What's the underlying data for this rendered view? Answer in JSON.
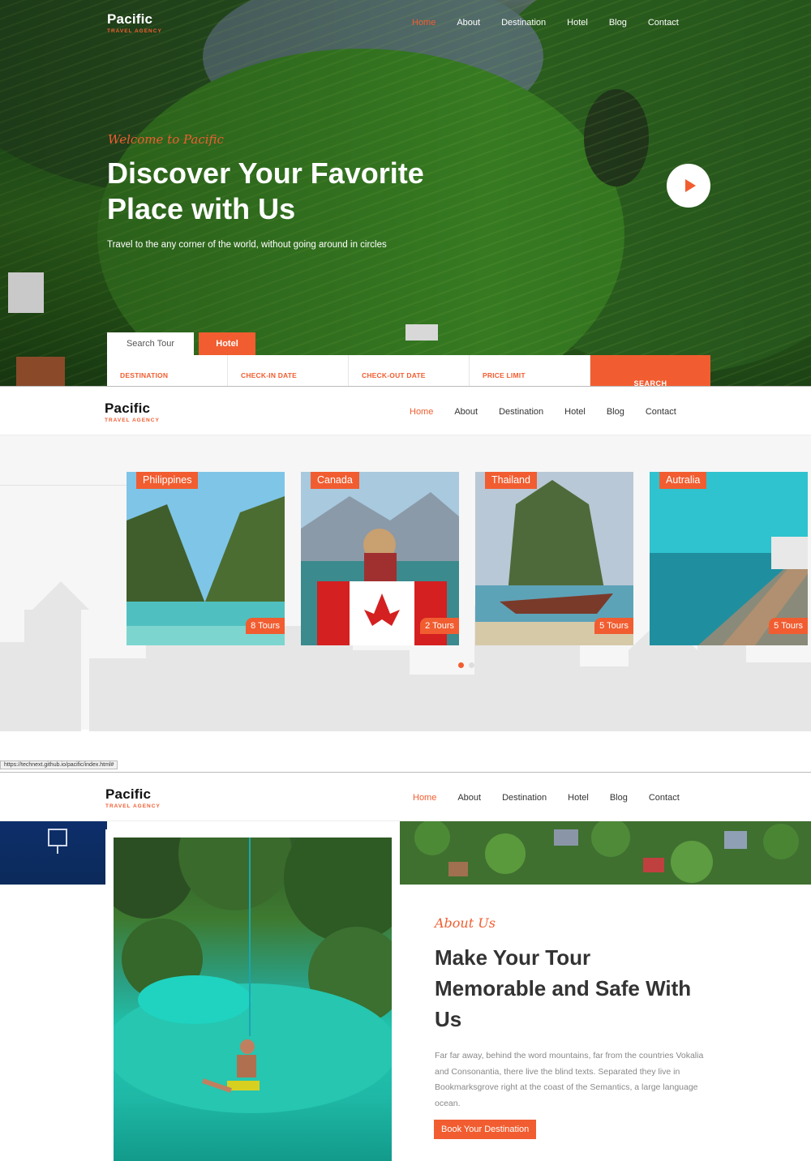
{
  "brand": {
    "name": "Pacific",
    "tagline": "TRAVEL AGENCY"
  },
  "nav": [
    "Home",
    "About",
    "Destination",
    "Hotel",
    "Blog",
    "Contact"
  ],
  "hero": {
    "welcome": "Welcome to Pacific",
    "title": "Discover Your Favorite Place with Us",
    "subtitle": "Travel to the any corner of the world, without going around in circles",
    "tabs": [
      "Search Tour",
      "Hotel"
    ],
    "fields": [
      "DESTINATION",
      "CHECK-IN DATE",
      "CHECK-OUT DATE",
      "PRICE LIMIT"
    ],
    "search_label": "SEARCH"
  },
  "destinations": [
    {
      "country": "Philippines",
      "tours": "8 Tours"
    },
    {
      "country": "Canada",
      "tours": "2 Tours"
    },
    {
      "country": "Thailand",
      "tours": "5 Tours"
    },
    {
      "country": "Autralia",
      "tours": "5 Tours"
    }
  ],
  "status_url": "https://technext.github.io/pacific/index.html#",
  "about": {
    "script": "About Us",
    "title": "Make Your Tour Memorable and Safe With Us",
    "text": "Far far away, behind the word mountains, far from the countries Vokalia and Consonantia, there live the blind texts. Separated they live in Bookmarksgrove right at the coast of the Semantics, a large language ocean.",
    "button": "Book Your Destination"
  },
  "colors": {
    "accent": "#f15d30"
  }
}
